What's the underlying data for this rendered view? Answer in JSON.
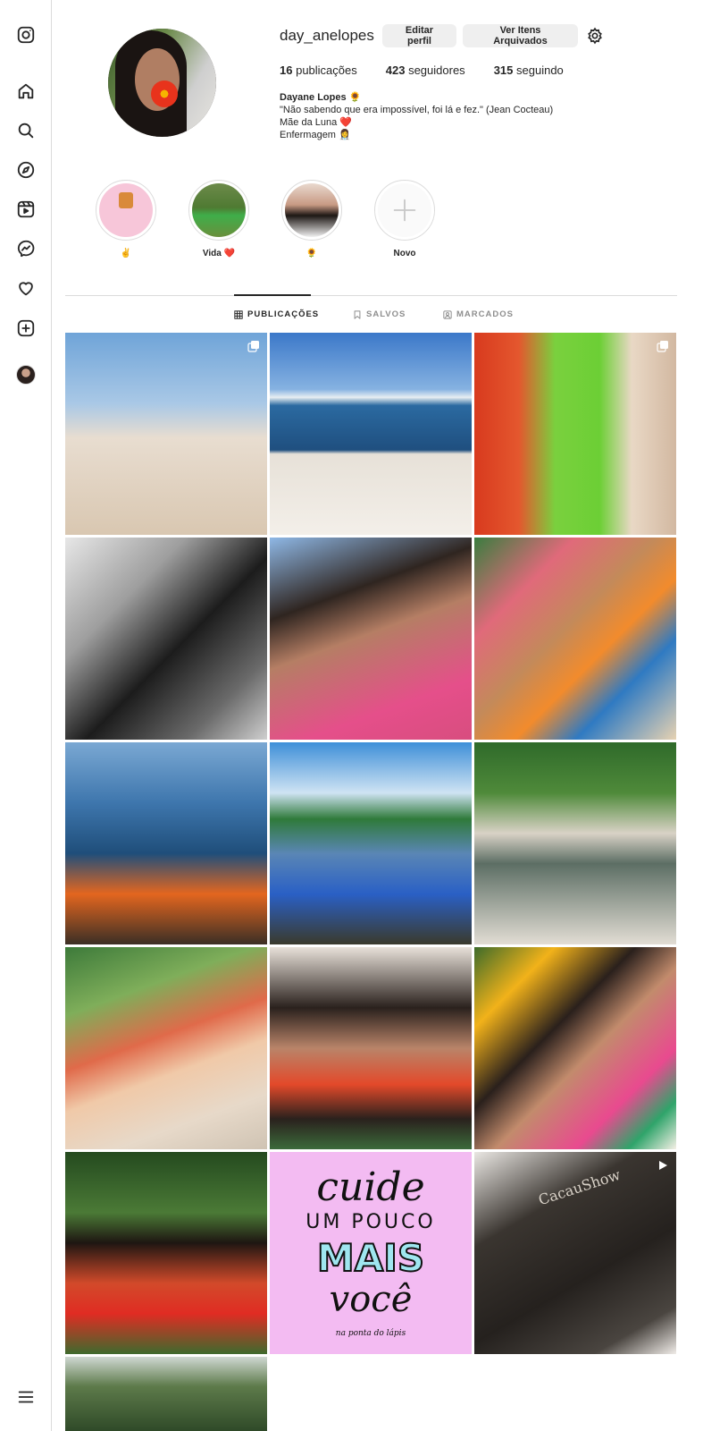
{
  "nav": {
    "items": [
      {
        "name": "instagram-logo-icon"
      },
      {
        "name": "home-icon"
      },
      {
        "name": "search-icon"
      },
      {
        "name": "explore-icon"
      },
      {
        "name": "reels-icon"
      },
      {
        "name": "messenger-icon"
      },
      {
        "name": "heart-icon"
      },
      {
        "name": "create-icon"
      }
    ],
    "menu_icon": "hamburger-icon"
  },
  "profile": {
    "username": "day_anelopes",
    "edit_label": "Editar perfil",
    "archive_label": "Ver Itens Arquivados",
    "stats": {
      "posts_count": "16",
      "posts_label": "publicações",
      "followers_count": "423",
      "followers_label": "seguidores",
      "following_count": "315",
      "following_label": "seguindo"
    },
    "bio": {
      "name": "Dayane Lopes 🌻",
      "line1": "\"Não sabendo que era impossível, foi lá e fez.\" (Jean Cocteau)",
      "line2": "Mãe da Luna ❤️",
      "line3": "Enfermagem 👩‍⚕️"
    }
  },
  "highlights": [
    {
      "label": "✌️"
    },
    {
      "label": "Vida ❤️"
    },
    {
      "label": "🌻"
    },
    {
      "label": "Novo"
    }
  ],
  "tabs": {
    "posts": "PUBLICAÇÕES",
    "saved": "SALVOS",
    "tagged": "MARCADOS"
  },
  "post_texts": {
    "quote_l1": "cuide",
    "quote_l2": "UM POUCO",
    "quote_l3": "MAIS",
    "quote_l4": "você",
    "quote_credit": "na ponta do lápis",
    "brand": "CacauShow"
  },
  "colors": {
    "accent": "#262626",
    "border": "#dbdbdb",
    "button_bg": "#efefef",
    "muted": "#8e8e8e"
  }
}
